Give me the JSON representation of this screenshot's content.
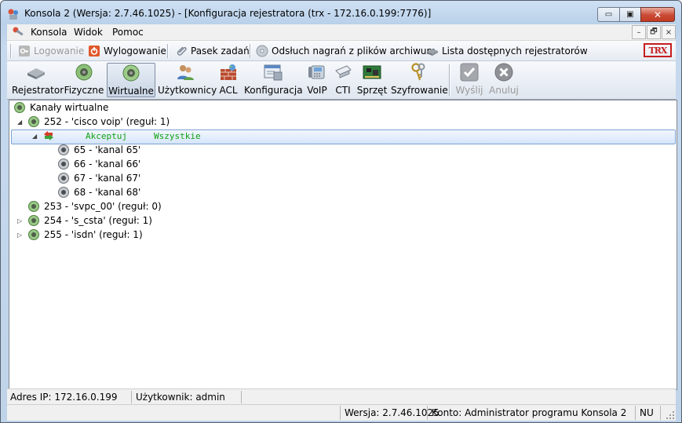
{
  "window": {
    "title": "Konsola 2 (Wersja:  2.7.46.1025) - [Konfiguracja rejestratora (trx - 172.16.0.199:7776)]",
    "controls": {
      "minimize": "▭",
      "maximize": "▣",
      "close": "✕"
    }
  },
  "menu": {
    "items": [
      "Konsola",
      "Widok",
      "Pomoc"
    ],
    "mdi_controls": [
      "–",
      "🗗",
      "×"
    ]
  },
  "toolbar": {
    "logowanie": "Logowanie",
    "wylogowanie": "Wylogowanie",
    "pasek_zadan": "Pasek zadań",
    "odsluch": "Odsłuch nagrań z plików archiwum",
    "lista": "Lista dostępnych rejestratorów",
    "logo": "TRX"
  },
  "ribbon": {
    "buttons": [
      "Rejestrator",
      "Fizyczne",
      "Wirtualne",
      "Użytkownicy",
      "ACL",
      "Konfiguracja",
      "VoIP",
      "CTI",
      "Sprzęt",
      "Szyfrowanie",
      "Wyślij",
      "Anuluj"
    ],
    "active": "Wirtualne"
  },
  "tree": {
    "root": "Kanały wirtualne",
    "channel_252": "252 - 'cisco voip' (reguł: 1)",
    "rule_action": "Akceptuj",
    "rule_scope": "Wszystkie",
    "sub_channels": [
      "65 - 'kanal 65'",
      "66 - 'kanal 66'",
      "67 - 'kanal 67'",
      "68 - 'kanal 68'"
    ],
    "channel_253": "253 - 'svpc_00' (reguł: 0)",
    "channel_254": "254 - 's_csta' (reguł: 1)",
    "channel_255": "255 - 'isdn' (reguł: 1)"
  },
  "status": {
    "ip": "Adres IP: 172.16.0.199",
    "user": "Użytkownik: admin",
    "version": "Wersja: 2.7.46.1025",
    "account": "Konto: Administrator programu Konsola 2",
    "num": "NU"
  },
  "colors": {
    "rule_text": "#12a012",
    "close_button": "#c94a35",
    "selection": "#d6e6fb"
  }
}
